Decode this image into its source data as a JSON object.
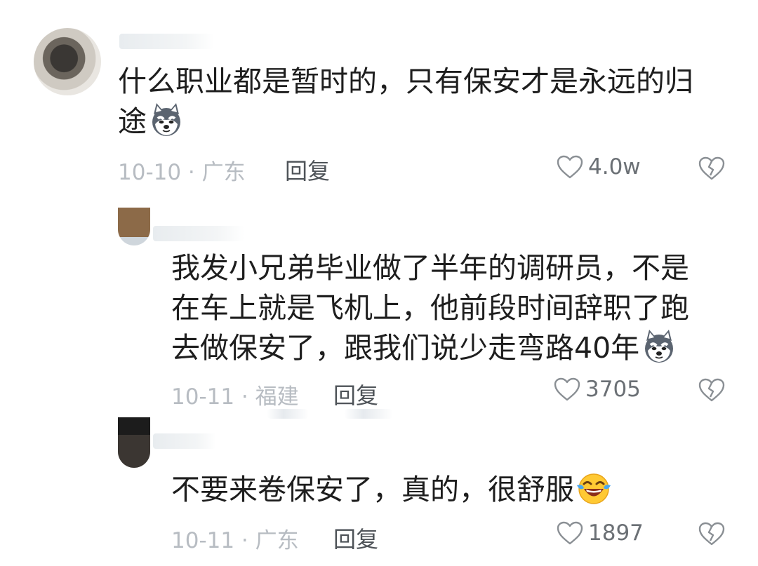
{
  "comments": [
    {
      "text": "什么职业都是暂时的，只有保安才是永远的归途",
      "emoji": "husky-dog-emoji",
      "meta": "10-10 · 广东",
      "reply_label": "回复",
      "like_count": "4.0w"
    },
    {
      "text": "我发小兄弟毕业做了半年的调研员，不是在车上就是飞机上，他前段时间辞职了跑去做保安了，跟我们说少走弯路40年",
      "emoji": "husky-dog-emoji",
      "meta": "10-11 · 福建",
      "reply_label": "回复",
      "like_count": "3705"
    },
    {
      "text": "不要来卷保安了，真的，很舒服",
      "emoji": "laughing-tears-emoji",
      "meta": "10-11 · 广东",
      "reply_label": "回复",
      "like_count": "1897"
    }
  ],
  "icons": {
    "like": "heart-outline-icon",
    "dislike": "broken-heart-icon"
  },
  "colors": {
    "text": "#1e1e1e",
    "meta": "#b7bcc2",
    "reply": "#4e5358",
    "like_count": "#6b7075",
    "icon": "#8a8f94"
  }
}
